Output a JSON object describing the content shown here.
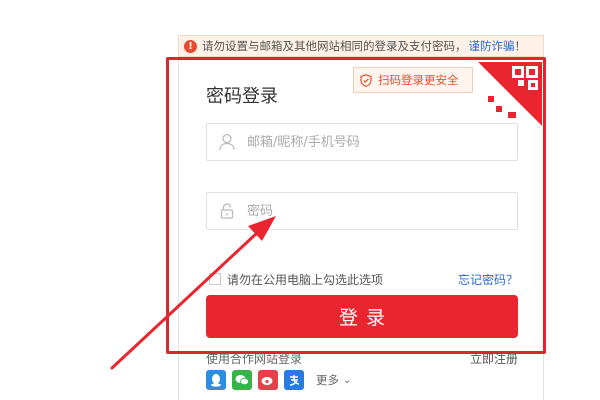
{
  "warning": {
    "text": "请勿设置与邮箱及其他网站相同的登录及支付密码，",
    "link": "谨防诈骗",
    "end": "！",
    "icon": "alert-circle-icon"
  },
  "login": {
    "title": "密码登录",
    "qr_tip": "扫码登录更安全",
    "username_placeholder": "邮箱/昵称/手机号码",
    "password_placeholder": "密码",
    "remember_label": "请勿在公用电脑上勾选此选项",
    "forgot_label": "忘记密码？",
    "submit_label": "登录"
  },
  "footer": {
    "partner_label": "使用合作网站登录",
    "register_label": "立即注册",
    "more_label": "更多",
    "social": [
      "qq-icon",
      "wechat-icon",
      "weibo-icon",
      "alipay-icon"
    ]
  },
  "colors": {
    "accent": "#e9262f",
    "highlight": "#e0242e",
    "link": "#2a6bd0"
  }
}
